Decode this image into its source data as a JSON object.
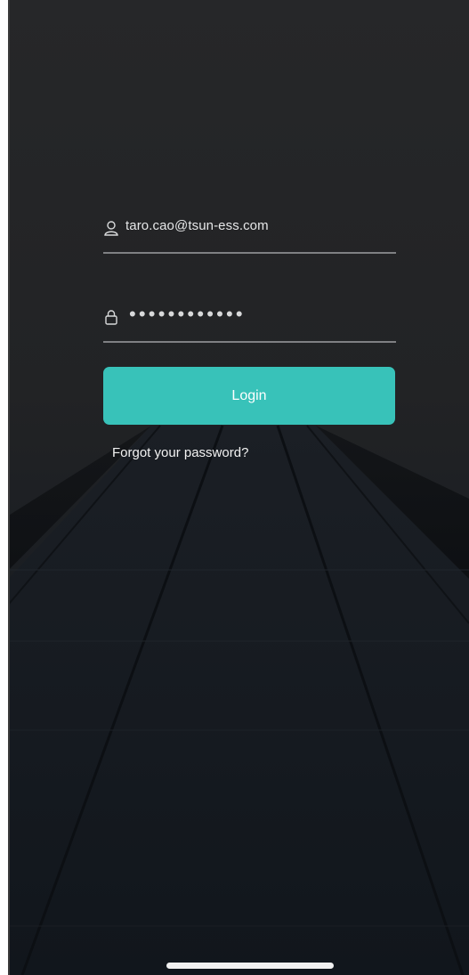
{
  "login": {
    "email_value": "taro.cao@tsun-ess.com",
    "password_mask": "••••••••••••",
    "login_label": "Login",
    "forgot_label": "Forgot your password?"
  },
  "icons": {
    "email": "user-icon",
    "password": "lock-icon"
  },
  "colors": {
    "accent": "#38c2b9",
    "background": "#1f2124"
  }
}
